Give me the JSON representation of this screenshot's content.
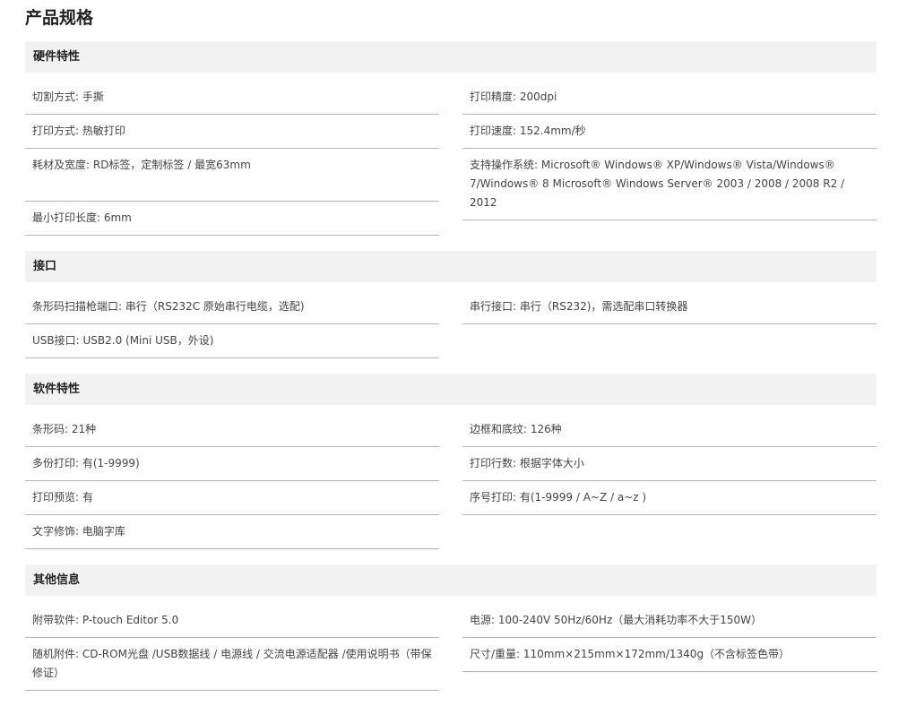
{
  "title": "产品规格",
  "sections": [
    {
      "heading": "硬件特性",
      "left": [
        "切割方式: 手撕",
        "打印方式: 热敏打印",
        "耗材及宽度: RD标签，定制标签 / 最宽63mm\n ",
        "最小打印长度: 6mm"
      ],
      "right": [
        "打印精度: 200dpi",
        "打印速度: 152.4mm/秒",
        "支持操作系统: Microsoft® Windows® XP/Windows® Vista/Windows® 7/Windows® 8 Microsoft® Windows Server® 2003 / 2008 / 2008 R2 / 2012"
      ]
    },
    {
      "heading": "接口",
      "left": [
        "条形码扫描枪端口: 串行（RS232C 原始串行电缆，选配)",
        "USB接口: USB2.0 (Mini USB，外设)"
      ],
      "right": [
        "串行接口: 串行（RS232)，需选配串口转换器"
      ]
    },
    {
      "heading": "软件特性",
      "left": [
        "条形码: 21种",
        "多份打印: 有(1-9999)",
        "打印预览: 有",
        "文字修饰: 电脑字库"
      ],
      "right": [
        "边框和底纹: 126种",
        "打印行数: 根据字体大小",
        "序号打印: 有(1-9999 / A~Z / a~z )"
      ]
    },
    {
      "heading": "其他信息",
      "left": [
        "附带软件: P-touch Editor 5.0",
        "随机附件: CD-ROM光盘 /USB数据线 / 电源线 / 交流电源适配器 /使用说明书（带保修证）"
      ],
      "right": [
        "电源: 100-240V 50Hz/60Hz（最大消耗功率不大于150W）",
        "尺寸/重量: 110mm×215mm×172mm/1340g（不含标签色带）"
      ]
    }
  ]
}
